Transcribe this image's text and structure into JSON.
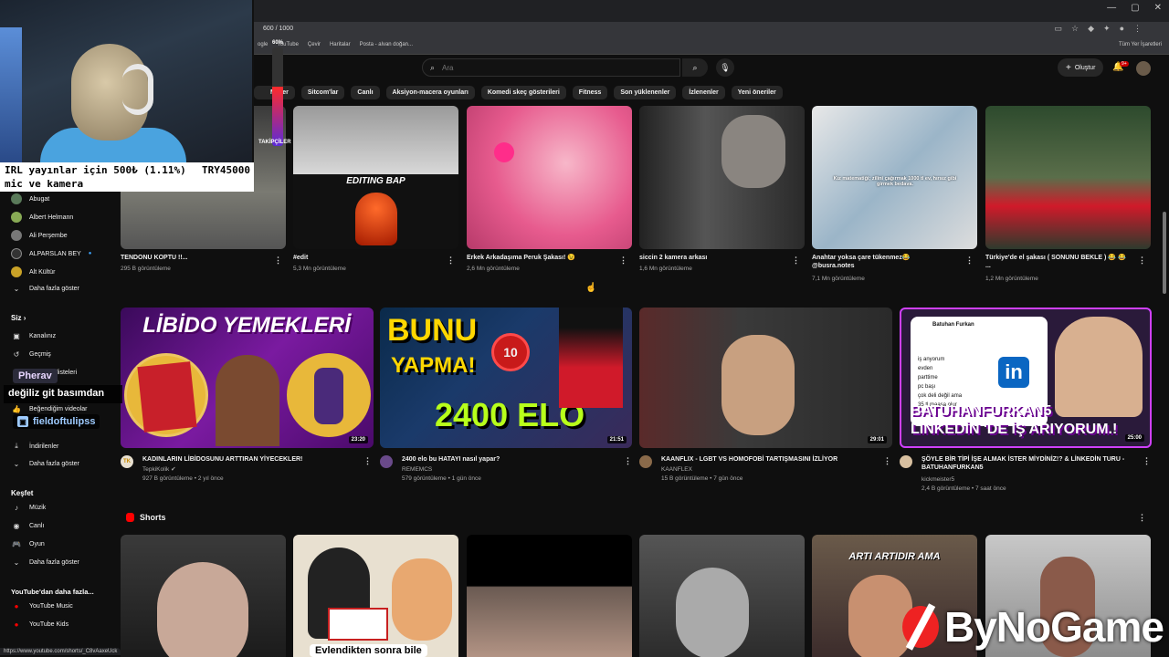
{
  "browser": {
    "counter": "600 / 1000",
    "bookmarks": [
      "ogle",
      "YouTube",
      "Çevir",
      "Haritalar",
      "Posta - alvan doğan..."
    ],
    "all_bookmarks": "Tüm Yer İşaretleri",
    "status_url": "https://www.youtube.com/shorts/_C8vAaxeUck"
  },
  "header": {
    "search_placeholder": "Ara",
    "create_label": "Oluştur",
    "notif_count": "9+"
  },
  "chips": [
    "Mizler",
    "Sitcom'lar",
    "Canlı",
    "Aksiyon-macera oyunları",
    "Komedi skeç gösterileri",
    "Fitness",
    "Son yüklenenler",
    "İzlenenler",
    "Yeni öneriler"
  ],
  "sidebar": {
    "subscriptions": [
      "Abugat",
      "Albert Helmann",
      "Ali Perşembe",
      "ALPARSLAN BEY",
      "Alt Kültür"
    ],
    "show_more": "Daha fazla göster",
    "you_header": "Siz",
    "you_items": [
      "Kanalınız",
      "Geçmiş",
      "Oynatma listeleri",
      "Beğendiğim videolar",
      "İndirilenler"
    ],
    "explore_header": "Keşfet",
    "explore_items": [
      "Müzik",
      "Canlı",
      "Oyun"
    ],
    "more_header": "YouTube'dan daha fazla...",
    "more_items": [
      "YouTube Music",
      "YouTube Kids"
    ]
  },
  "overlay": {
    "donation_line1": "IRL yayınlar için",
    "donation_progress": "500₺ (1.11%)",
    "donation_target": "TRY45000",
    "donation_line2": "mic ve kamera",
    "follower_pct_label": "60%",
    "follower_fraction": 0.6,
    "follower_label": "TAKİPÇİLER",
    "chat_name": "Pherav",
    "chat_message": "değiliz git basımdan",
    "chat_user2": "fieldoftulipss",
    "watermark": "ByNoGame"
  },
  "row1": [
    {
      "title": "TENDONU KOPTU !!...",
      "meta": "295 B görüntüleme"
    },
    {
      "title": "#edit",
      "meta": "5,3 Mn görüntüleme",
      "overlay": "EDITING BAP"
    },
    {
      "title": "Erkek Arkadaşıma Peruk Şakası! 😉",
      "meta": "2,6 Mn görüntüleme"
    },
    {
      "title": "siccin 2 kamera arkası",
      "meta": "1,6 Mn görüntüleme"
    },
    {
      "title": "Anahtar yoksa çare tükenmez😂 @busra.notes",
      "meta": "7,1 Mn görüntüleme",
      "overlay": "Kız matematiği; zilini çağırmak 1000 tl ev, hırsız gibi girmek bedava."
    },
    {
      "title": "Türkiye'de el şakası ( SONUNU BEKLE ) 😂 😂 ...",
      "meta": "1,2 Mn görüntüleme"
    }
  ],
  "row2": [
    {
      "title": "KADINLARIN LİBİDOSUNU ARTTIRAN YİYECEKLER!",
      "channel": "TepkiKolik",
      "meta": "927 B görüntüleme • 2 yıl önce",
      "duration": "23:20",
      "thumb_text": "LİBİDO YEMEKLERİ",
      "avatar_text": "TK"
    },
    {
      "title": "2400 elo bu HATAYI nasıl yapar?",
      "channel": "REMEMCS",
      "meta": "579 görüntüleme • 1 gün önce",
      "duration": "21:51",
      "thumb_text1": "BUNU",
      "thumb_text2": "YAPMA!",
      "thumb_text3": "2400 ELO",
      "badge": "10"
    },
    {
      "title": "KAANFLIX - LGBT VS HOMOFOBİ TARTIŞMASINI İZLİYOR",
      "channel": "KAANFLEX",
      "meta": "15 B görüntüleme • 7 gün önce",
      "duration": "29:01"
    },
    {
      "title": "ŞÖYLE BİR TİPİ İŞE ALMAK İSTER MİYDİNİZ!? & LİNKEDİN TURU - BATUHANFURKAN5",
      "channel": "kickmeister5",
      "meta": "2,4 B görüntüleme • 7 saat önce",
      "duration": "25:00",
      "thumb_text1": "BATUHANFURKAN5",
      "thumb_text2": "LINKEDİN 'DE İŞ ARIYORUM.!",
      "card_name": "Batuhan Furkan",
      "card_lines": [
        "iş anyorum",
        "evden",
        "parttime",
        "pc başı",
        "çok deli değil ama",
        "35 tl maaşa olur"
      ]
    }
  ],
  "shorts": {
    "header": "Shorts",
    "captions": [
      "",
      "Evlendikten sonra bile",
      "",
      "",
      "ARTI ARTIDIR AMA",
      ""
    ]
  }
}
